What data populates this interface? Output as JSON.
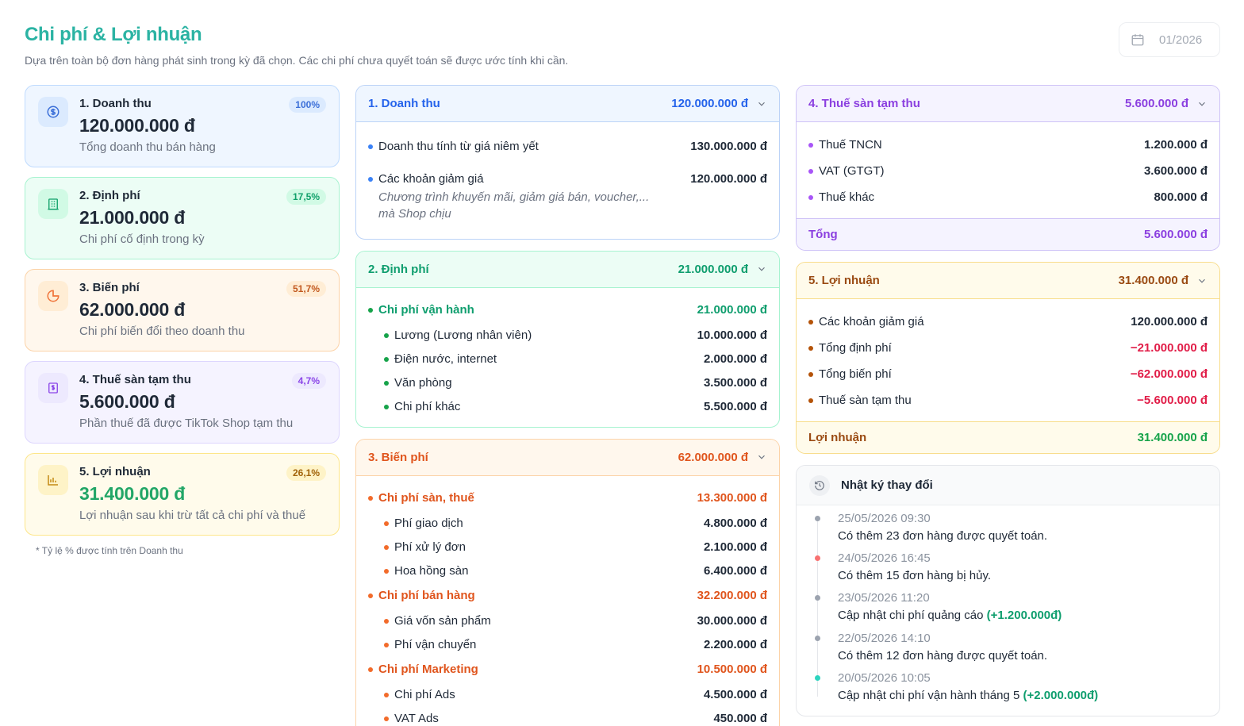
{
  "header": {
    "title": "Chi phí & Lợi nhuận",
    "subtitle": "Dựa trên toàn bộ đơn hàng phát sinh trong kỳ đã chọn. Các chi phí chưa quyết toán sẽ được ước tính khi cần.",
    "period": "01/2026"
  },
  "summary": [
    {
      "title": "1. Doanh thu",
      "value": "120.000.000 đ",
      "desc": "Tổng doanh thu bán hàng",
      "pct": "100%",
      "icon": "dollar-coin-icon"
    },
    {
      "title": "2. Định phí",
      "value": "21.000.000 đ",
      "desc": "Chi phí cố định trong kỳ",
      "pct": "17,5%",
      "icon": "building-icon"
    },
    {
      "title": "3. Biến phí",
      "value": "62.000.000 đ",
      "desc": "Chi phí biến đổi theo doanh thu",
      "pct": "51,7%",
      "icon": "pie-chart-icon"
    },
    {
      "title": "4. Thuế sàn tạm thu",
      "value": "5.600.000 đ",
      "desc": "Phần thuế đã được TikTok Shop tạm thu",
      "pct": "4,7%",
      "icon": "receipt-icon"
    },
    {
      "title": "5. Lợi nhuận",
      "value": "31.400.000 đ",
      "desc": "Lợi nhuận sau khi trừ tất cả chi phí và thuế",
      "pct": "26,1%",
      "icon": "bar-chart-icon"
    }
  ],
  "footnote": "* Tỷ lệ % được tính trên Doanh thu",
  "revenue": {
    "title": "1. Doanh thu",
    "total": "120.000.000 đ",
    "rows": [
      {
        "label": "Doanh thu tính từ giá niêm yết",
        "value": "130.000.000 đ"
      },
      {
        "label": "Các khoản giảm giá",
        "value": "120.000.000 đ",
        "note": "Chương trình khuyến mãi, giảm giá bán, voucher,... mà Shop chịu"
      }
    ]
  },
  "fixed": {
    "title": "2. Định phí",
    "total": "21.000.000 đ",
    "group": {
      "label": "Chi phí vận hành",
      "value": "21.000.000 đ"
    },
    "rows": [
      {
        "label": "Lương (Lương nhân viên)",
        "value": "10.000.000 đ"
      },
      {
        "label": "Điện nước, internet",
        "value": "2.000.000 đ"
      },
      {
        "label": "Văn phòng",
        "value": "3.500.000 đ"
      },
      {
        "label": "Chi phí khác",
        "value": "5.500.000 đ"
      }
    ]
  },
  "variable": {
    "title": "3. Biến phí",
    "total": "62.000.000 đ",
    "groups": [
      {
        "label": "Chi phí sàn, thuế",
        "value": "13.300.000 đ",
        "rows": [
          {
            "label": "Phí giao dịch",
            "value": "4.800.000 đ"
          },
          {
            "label": "Phí xử lý đơn",
            "value": "2.100.000 đ"
          },
          {
            "label": "Hoa hồng sàn",
            "value": "6.400.000 đ"
          }
        ]
      },
      {
        "label": "Chi phí bán hàng",
        "value": "32.200.000 đ",
        "rows": [
          {
            "label": "Giá vốn sản phẩm",
            "value": "30.000.000 đ"
          },
          {
            "label": "Phí vận chuyển",
            "value": "2.200.000 đ"
          }
        ]
      },
      {
        "label": "Chi phí Marketing",
        "value": "10.500.000 đ",
        "rows": [
          {
            "label": "Chi phí Ads",
            "value": "4.500.000 đ"
          },
          {
            "label": "VAT Ads",
            "value": "450.000 đ"
          }
        ]
      }
    ]
  },
  "tax": {
    "title": "4. Thuế sàn tạm thu",
    "total": "5.600.000 đ",
    "rows": [
      {
        "label": "Thuế TNCN",
        "value": "1.200.000 đ"
      },
      {
        "label": "VAT (GTGT)",
        "value": "3.600.000 đ"
      },
      {
        "label": "Thuế khác",
        "value": "800.000 đ"
      }
    ],
    "footer_label": "Tổng",
    "footer_value": "5.600.000 đ"
  },
  "profit": {
    "title": "5. Lợi nhuận",
    "total": "31.400.000 đ",
    "rows": [
      {
        "label": "Các khoản giảm giá",
        "value": "120.000.000 đ"
      },
      {
        "label": "Tổng định phí",
        "value": "−21.000.000 đ"
      },
      {
        "label": "Tổng biến phí",
        "value": "−62.000.000 đ"
      },
      {
        "label": "Thuế sàn tạm thu",
        "value": "−5.600.000 đ"
      }
    ],
    "footer_label": "Lợi nhuận",
    "footer_value": "31.400.000 đ"
  },
  "changelog": {
    "title": "Nhật ký thay đổi",
    "entries": [
      {
        "time": "25/05/2026 09:30",
        "text": "Có thêm 23 đơn hàng được quyết toán.",
        "amount": "",
        "dot": "#9ca3af"
      },
      {
        "time": "24/05/2026 16:45",
        "text": "Có thêm 15 đơn hàng bị hủy.",
        "amount": "",
        "dot": "#f87171"
      },
      {
        "time": "23/05/2026 11:20",
        "text": "Cập nhật chi phí quảng cáo",
        "amount": "(+1.200.000đ)",
        "dot": "#9ca3af"
      },
      {
        "time": "22/05/2026 14:10",
        "text": "Có thêm 12 đơn hàng được quyết toán.",
        "amount": "",
        "dot": "#9ca3af"
      },
      {
        "time": "20/05/2026 10:05",
        "text": "Cập nhật chi phí vận hành tháng 5",
        "amount": "(+2.000.000đ)",
        "dot": "#2dd4bf"
      }
    ]
  }
}
